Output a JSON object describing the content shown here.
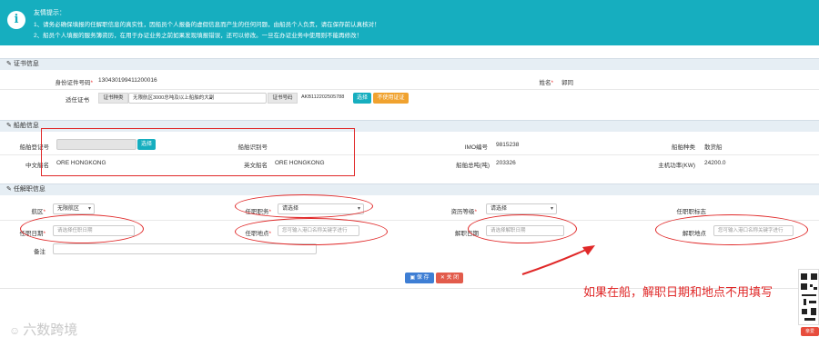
{
  "tip": {
    "icon": "info-icon",
    "title": "友情提示：",
    "line1": "1、请务必确保填报的任解职信息的真实性，因船员个人报备的虚假信息而产生的任何问题，由船员个人负责，请在保存前认真核对！",
    "line2": "2、船员个人填报的服务簿资历，在用于办证业务之前如果发现填报错误，还可以修改。一旦在办证业务中使用则不能再修改！"
  },
  "cert_section": {
    "title": "证书信息",
    "id_label": "身份证件号码",
    "id_value": "130430199411200016",
    "name_label": "姓名",
    "name_value": "郭同",
    "cert_label": "适任证书",
    "cert_type_tag": "证书种类",
    "cert_type_value": "无限航区3000总吨及以上船舶的大副",
    "cert_no_tag": "证书号码",
    "cert_no_value": "AKB112202505788",
    "select_button": "选择",
    "not_use_button": "不使用证证"
  },
  "ship_section": {
    "title": "船舶信息",
    "reg_no_label": "船舶登记号",
    "reg_no_value": "",
    "select_button": "选择",
    "ship_id_label": "船舶识别号",
    "imo_label": "IMO编号",
    "imo_value": "9815238",
    "ship_type_label": "船舶种类",
    "ship_type_value": "散货船",
    "cn_name_label": "中文船名",
    "cn_name_value": "ORE HONGKONG",
    "en_name_label": "英文船名",
    "en_name_value": "ORE HONGKONG",
    "gt_label": "船舶总吨(吨)",
    "gt_value": "203326",
    "power_label": "主机功率(KW)",
    "power_value": "24200.0"
  },
  "duty_section": {
    "title": "任解职信息",
    "area_label": "航区",
    "area_value": "无限航区",
    "post_label": "任职职务",
    "post_value": "请选择",
    "level_label": "资历等级",
    "level_value": "请选择",
    "flag_label": "任职职标志",
    "start_date_label": "任职日期",
    "start_date_placeholder": "请选择任职日期",
    "start_place_label": "任职地点",
    "start_place_placeholder": "您可输入港口名称关键字进行",
    "end_date_label": "解职日期",
    "end_date_placeholder": "请选择解职日期",
    "end_place_label": "解职地点",
    "end_place_placeholder": "您可输入港口名称关键字进行",
    "remark_label": "备注",
    "remark_value": ""
  },
  "actions": {
    "save": "保 存",
    "close": "关 闭"
  },
  "annotation": {
    "text": "如果在船，解职日期和地点不用填写",
    "color": "#e02828"
  },
  "watermark": "六数跨境",
  "qr_label": "亲爱",
  "colors": {
    "banner": "#16aebf",
    "section_bg": "#e6eef4",
    "save_button": "#3e7ed4",
    "close_button": "#e25b4b",
    "orange_button": "#f0a22f"
  }
}
